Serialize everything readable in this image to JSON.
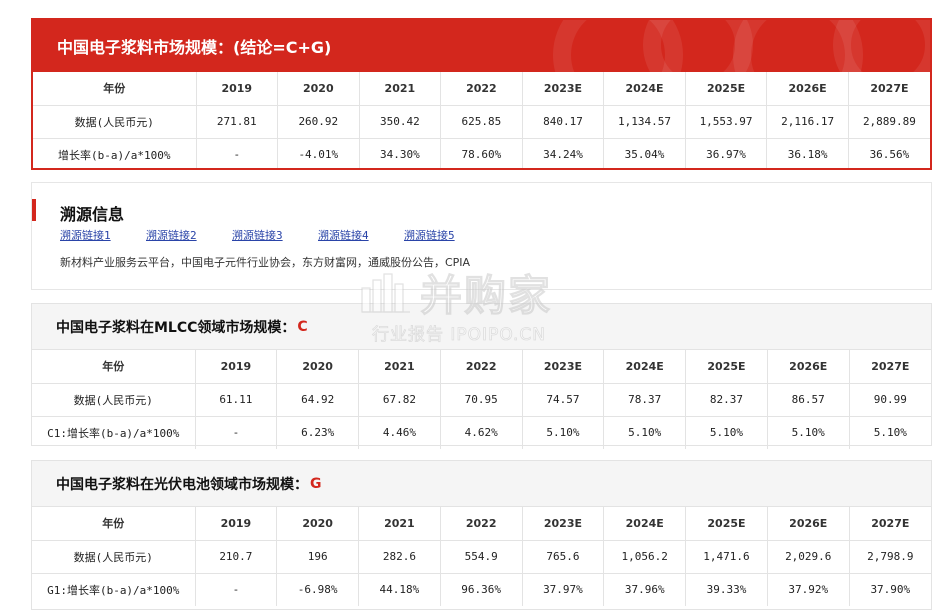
{
  "main": {
    "title": "中国电子浆料市场规模：(结论=C+G)",
    "rows": [
      [
        "年份",
        "2019",
        "2020",
        "2021",
        "2022",
        "2023E",
        "2024E",
        "2025E",
        "2026E",
        "2027E"
      ],
      [
        "数据(人民币元)",
        "271.81",
        "260.92",
        "350.42",
        "625.85",
        "840.17",
        "1,134.57",
        "1,553.97",
        "2,116.17",
        "2,889.89"
      ],
      [
        "增长率(b-a)/a*100%",
        "-",
        "-4.01%",
        "34.30%",
        "78.60%",
        "34.24%",
        "35.04%",
        "36.97%",
        "36.18%",
        "36.56%"
      ]
    ]
  },
  "source": {
    "title": "溯源信息",
    "links": [
      "溯源链接1",
      "溯源链接2",
      "溯源链接3",
      "溯源链接4",
      "溯源链接5"
    ],
    "text": "新材料产业服务云平台，中国电子元件行业协会，东方财富网，通威股份公告，CPIA"
  },
  "mlcc": {
    "title": "中国电子浆料在MLCC领域市场规模：",
    "tag": "C",
    "rows": [
      [
        "年份",
        "2019",
        "2020",
        "2021",
        "2022",
        "2023E",
        "2024E",
        "2025E",
        "2026E",
        "2027E"
      ],
      [
        "数据(人民币元)",
        "61.11",
        "64.92",
        "67.82",
        "70.95",
        "74.57",
        "78.37",
        "82.37",
        "86.57",
        "90.99"
      ],
      [
        "C1:增长率(b-a)/a*100%",
        "-",
        "6.23%",
        "4.46%",
        "4.62%",
        "5.10%",
        "5.10%",
        "5.10%",
        "5.10%",
        "5.10%"
      ]
    ]
  },
  "pv": {
    "title": "中国电子浆料在光伏电池领域市场规模：",
    "tag": "G",
    "rows": [
      [
        "年份",
        "2019",
        "2020",
        "2021",
        "2022",
        "2023E",
        "2024E",
        "2025E",
        "2026E",
        "2027E"
      ],
      [
        "数据(人民币元)",
        "210.7",
        "196",
        "282.6",
        "554.9",
        "765.6",
        "1,056.2",
        "1,471.6",
        "2,029.6",
        "2,798.9"
      ],
      [
        "G1:增长率(b-a)/a*100%",
        "-",
        "-6.98%",
        "44.18%",
        "96.36%",
        "37.97%",
        "37.96%",
        "39.33%",
        "37.92%",
        "37.90%"
      ]
    ]
  },
  "watermark": {
    "main": "并购家",
    "sub": "行业报告 IPOIPO.CN"
  },
  "colors": {
    "accent": "#d3271d",
    "link": "#2a44a8"
  }
}
